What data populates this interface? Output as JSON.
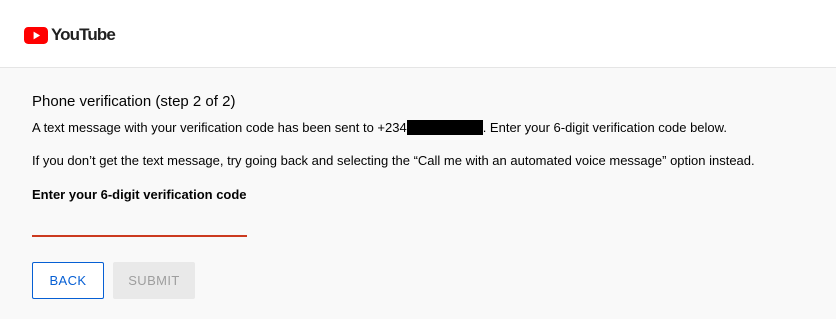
{
  "header": {
    "logo_text": "YouTube",
    "logo_icon": "youtube-play-icon",
    "brand_color": "#ff0000"
  },
  "verification": {
    "title": "Phone verification (step 2 of 2)",
    "sent_prefix": "A text message with your verification code has been sent to +234",
    "sent_suffix": ". Enter your 6-digit verification code below.",
    "help_text": "If you don’t get the text message, try going back and selecting the “Call me with an automated voice message” option instead.",
    "code_label": "Enter your 6-digit verification code",
    "code_value": "",
    "input_underline_color": "#cc3a1f"
  },
  "actions": {
    "back_label": "BACK",
    "submit_label": "SUBMIT",
    "accent_color": "#065fd4"
  }
}
